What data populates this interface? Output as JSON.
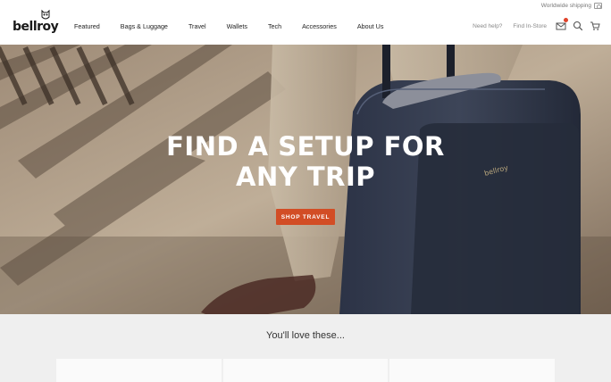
{
  "header": {
    "logo_text": "bellroy",
    "shipping": "Worldwide shipping",
    "nav": [
      {
        "label": "Featured"
      },
      {
        "label": "Bags & Luggage"
      },
      {
        "label": "Travel"
      },
      {
        "label": "Wallets"
      },
      {
        "label": "Tech"
      },
      {
        "label": "Accessories"
      },
      {
        "label": "About Us"
      }
    ],
    "utility": {
      "help": "Need help?",
      "store": "Find In-Store"
    },
    "icons": [
      "mail-icon",
      "search-icon",
      "cart-icon"
    ]
  },
  "hero": {
    "title_line1": "FIND A SETUP FOR",
    "title_line2": "ANY TRIP",
    "button": "SHOP TRAVEL",
    "suitcase_brand": "bellroy"
  },
  "love": {
    "title": "You'll love these..."
  },
  "colors": {
    "accent": "#d24d25",
    "badge": "#e0432b",
    "section_bg": "#efefef"
  }
}
